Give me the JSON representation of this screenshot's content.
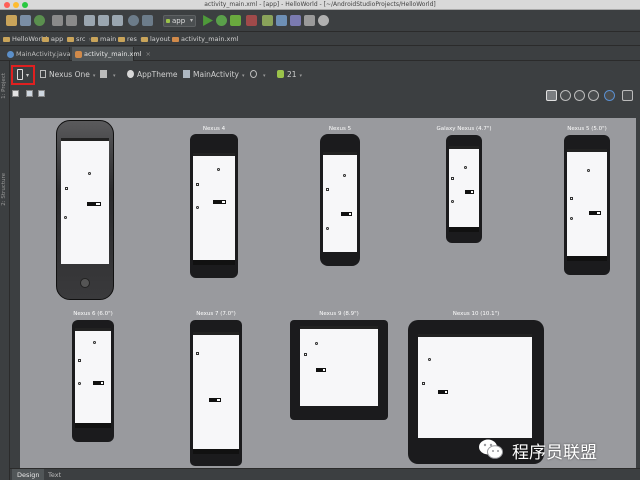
{
  "window": {
    "title": "activity_main.xml - [app] - HelloWorld - [~/AndroidStudioProjects/HelloWorld]"
  },
  "toolbar": {
    "run_config": "app",
    "run_config_arrow": "▾"
  },
  "breadcrumb": [
    "HelloWorld",
    "app",
    "src",
    "main",
    "res",
    "layout",
    "activity_main.xml"
  ],
  "editor_tabs": [
    {
      "label": "MainActivity.java",
      "active": false
    },
    {
      "label": "activity_main.xml",
      "active": true
    }
  ],
  "tab_close": "×",
  "left_strip": [
    "1: Project",
    "2: Structure"
  ],
  "layout_toolbar": {
    "device": "Nexus One",
    "theme": "AppTheme",
    "activity": "MainActivity",
    "api": "21",
    "dropdown_arrow": "▾"
  },
  "devices": [
    {
      "label": ""
    },
    {
      "label": "Nexus 4"
    },
    {
      "label": "Nexus 5"
    },
    {
      "label": "Galaxy Nexus (4.7\")"
    },
    {
      "label": "Nexus 5 (5.0\")"
    },
    {
      "label": "Nexus 6 (6.0\")"
    },
    {
      "label": "Nexus 7 (7.0\")"
    },
    {
      "label": "Nexus 9 (8.9\")"
    },
    {
      "label": "Nexus 10 (10.1\")"
    }
  ],
  "bottom_tabs": [
    {
      "label": "Design",
      "active": true
    },
    {
      "label": "Text",
      "active": false
    }
  ],
  "watermark": {
    "text": "程序员联盟"
  },
  "colors": {
    "ide_background": "#3c3f41",
    "canvas": "#999a9e",
    "selection_highlight": "#e02020",
    "folder": "#c9a45a"
  }
}
